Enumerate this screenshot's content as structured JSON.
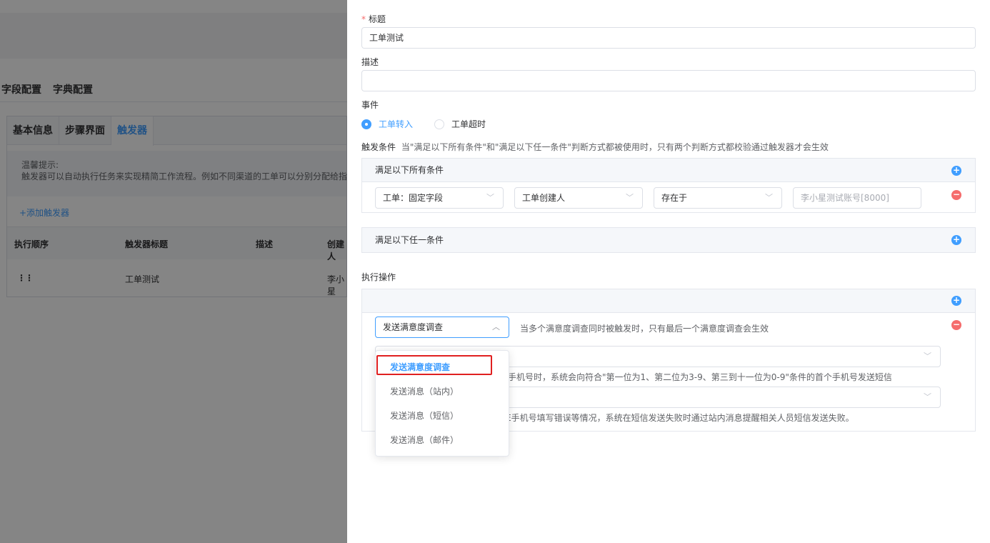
{
  "background_page": {
    "config_tabs": [
      "字段配置",
      "字典配置"
    ],
    "tabs": [
      "基本信息",
      "步骤界面",
      "触发器"
    ],
    "tip_title": "温馨提示:",
    "tip_text": "触发器可以自动执行任务来实现精简工作流程。例如不同渠道的工单可以分别分配给指",
    "add_trigger": "+添加触发器",
    "table_headers": [
      "执行顺序",
      "触发器标题",
      "描述",
      "创建人"
    ],
    "row": {
      "title": "工单测试",
      "creator": "李小星"
    }
  },
  "form": {
    "title_label": "标题",
    "title_value": "工单测试",
    "desc_label": "描述",
    "desc_value": "",
    "event_label": "事件",
    "event_options": [
      "工单转入",
      "工单超时"
    ],
    "event_selected": "工单转入",
    "trigger_label": "触发条件",
    "trigger_hint": "当\"满足以下所有条件\"和\"满足以下任一条件\"判断方式都被使用时，只有两个判断方式都校验通过触发器才会生效",
    "all_conditions_title": "满足以下所有条件",
    "condition_row": {
      "field_type": "工单：固定字段",
      "field": "工单创建人",
      "operator": "存在于",
      "value_placeholder": "李小星测试账号[8000]"
    },
    "any_conditions_title": "满足以下任一条件",
    "action_label": "执行操作",
    "action_select": "发送满意度调查",
    "action_hint": "当多个满意度调查同时被触发时，只有最后一个满意度调查会生效",
    "hidden_hint_1": "手机号时，系统会向符合\"第一位为1、第二位为3-9、第三到十一位为0-9\"条件的首个手机号发送短信",
    "hidden_hint_2": "E手机号填写错误等情况，系统在短信发送失败时通过站内消息提醒相关人员短信发送失败。"
  },
  "dropdown": {
    "options": [
      "发送满意度调查",
      "发送消息（站内）",
      "发送消息（短信）",
      "发送消息（邮件）"
    ],
    "selected": "发送满意度调查"
  },
  "colors": {
    "accent": "#409eff",
    "danger": "#f56c6c",
    "highlight": "#e02020"
  }
}
